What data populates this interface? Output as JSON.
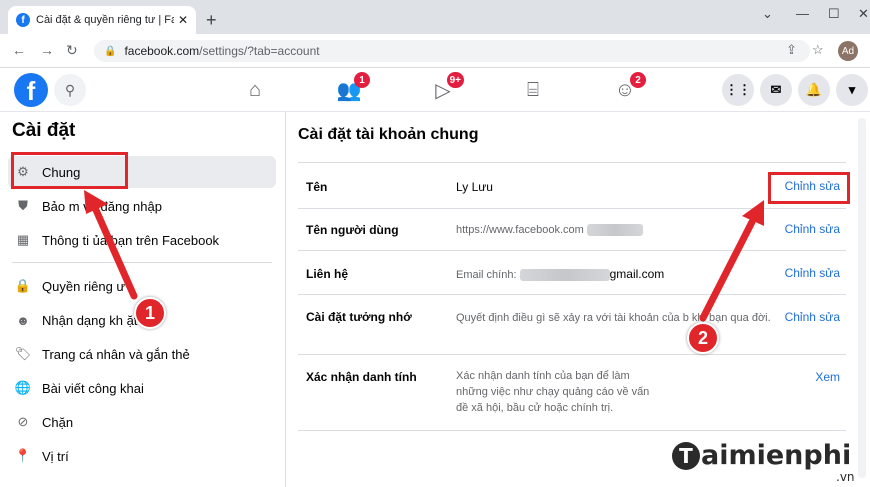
{
  "browser": {
    "tab_title": "Cài đặt & quyền riêng tư | Faceb",
    "tab_favicon": "f",
    "new_tab": "+",
    "url_host": "facebook.com",
    "url_path": "/settings/?tab=account",
    "profile_initials": "Ad"
  },
  "fb_topbar": {
    "logo": "f",
    "badges": {
      "friends": "1",
      "watch": "9+",
      "groups": "2"
    }
  },
  "sidebar": {
    "title": "Cài đặt",
    "items": [
      {
        "label": "Chung",
        "icon": "gear-icon"
      },
      {
        "label": "Bảo m   và đăng nhập",
        "icon": "shield-icon"
      },
      {
        "label": "Thông ti   ủa bạn trên Facebook",
        "icon": "facebook-info-icon"
      },
      {
        "label": "Quyền riêng  ư",
        "icon": "lock-icon"
      },
      {
        "label": "Nhận dạng kh     ặt",
        "icon": "face-recognition-icon"
      },
      {
        "label": "Trang cá nhân và gắn thẻ",
        "icon": "tag-icon"
      },
      {
        "label": "Bài viết công khai",
        "icon": "globe-icon"
      },
      {
        "label": "Chặn",
        "icon": "block-user-icon"
      },
      {
        "label": "Vị trí",
        "icon": "location-pin-icon"
      }
    ]
  },
  "main": {
    "title": "Cài đặt tài khoản chung",
    "rows": [
      {
        "label": "Tên",
        "value": "Ly Lưu",
        "action": "Chỉnh sửa"
      },
      {
        "label": "Tên người dùng",
        "value": "https://www.facebook.com",
        "action": "Chỉnh sửa"
      },
      {
        "label": "Liên hệ",
        "value_prefix": "Email chính:",
        "value_suffix": "gmail.com",
        "action": "Chỉnh sửa"
      },
      {
        "label": "Cài đặt tưởng nhớ",
        "value": "Quyết định điều gì sẽ xảy ra với tài khoản của b       khi bạn qua đời.",
        "action": "Chỉnh sửa"
      },
      {
        "label": "Xác nhận danh tính",
        "value": "Xác nhận danh tính của bạn để làm những việc như chạy quảng cáo về vấn đề xã hội, bầu cử hoặc chính trị.",
        "action": "Xem"
      }
    ]
  },
  "annotations": {
    "step1": "1",
    "step2": "2",
    "color": "#e0262a"
  },
  "watermark": {
    "brand": "aimienphi",
    "initial": "T",
    "suffix": ".vn"
  },
  "colors": {
    "fb_blue": "#1877f2",
    "link_blue": "#216fdb",
    "badge_red": "#e41e3f"
  }
}
